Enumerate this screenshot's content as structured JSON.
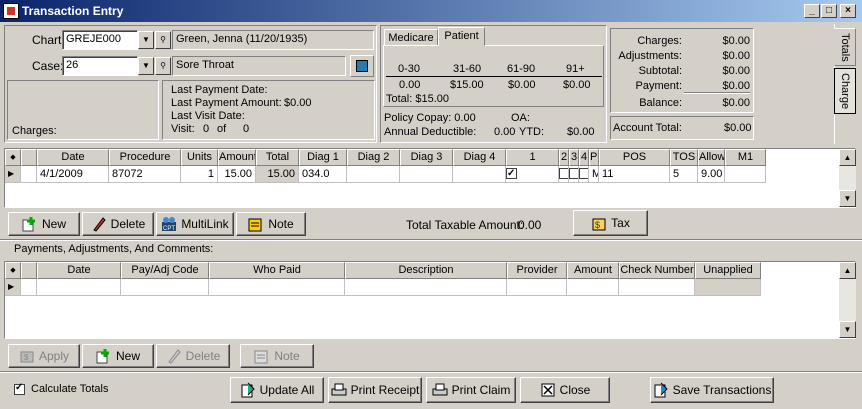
{
  "window": {
    "title": "Transaction Entry",
    "min": "_",
    "max": "□",
    "close": "×"
  },
  "patient": {
    "chart_label": "Chart:",
    "chart_value": "GREJE000",
    "name": "Green, Jenna  (11/20/1935)",
    "case_label": "Case:",
    "case_value": "26",
    "case_desc": "Sore Throat",
    "charges_label": "Charges:"
  },
  "last_info": {
    "l1": "Last Payment Date:",
    "l2": "Last Payment Amount:",
    "l2v": "$0.00",
    "l3": "Last Visit Date:",
    "l4": "Visit:",
    "l4a": "0",
    "l4b": "of",
    "l4c": "0"
  },
  "aging": {
    "tabs": [
      "Medicare",
      "Patient"
    ],
    "active_tab": "Patient",
    "headers": [
      "0-30",
      "31-60",
      "61-90",
      "91+"
    ],
    "values": [
      "0.00",
      "$15.00",
      "$0.00",
      "$0.00"
    ],
    "total": "Total: $15.00"
  },
  "policy": {
    "copay": "Policy Copay: 0.00",
    "oa": "OA:",
    "deduct": "Annual Deductible:",
    "deduct_v": "0.00",
    "ytd": "YTD:",
    "ytd_v": "$0.00"
  },
  "totals": {
    "rows": [
      [
        "Charges:",
        "$0.00"
      ],
      [
        "Adjustments:",
        "$0.00"
      ],
      [
        "Subtotal:",
        "$0.00"
      ],
      [
        "Payment:",
        "$0.00"
      ],
      [
        "Balance:",
        "$0.00"
      ]
    ],
    "account_label": "Account Total:",
    "account_value": "$0.00"
  },
  "side_tabs": [
    "Totals",
    "Charge"
  ],
  "charges_grid": {
    "columns": [
      "Date",
      "Procedure",
      "Units",
      "Amount",
      "Total",
      "Diag 1",
      "Diag 2",
      "Diag 3",
      "Diag 4",
      "1",
      "2",
      "3",
      "4",
      "Provider",
      "POS",
      "TOS",
      "Allowed",
      "M1"
    ],
    "row": {
      "date": "4/1/2009",
      "procedure": "87072",
      "units": "1",
      "amount": "15.00",
      "total": "15.00",
      "diag1": "034.0",
      "provider": "MM",
      "pos": "11",
      "tos": "5",
      "allowed": "9.00"
    }
  },
  "charge_buttons": {
    "new": "New",
    "delete": "Delete",
    "multilink": "MultiLink",
    "note": "Note",
    "taxable": "Total Taxable Amount:",
    "taxable_v": "0.00",
    "tax": "Tax"
  },
  "payments": {
    "section_label": "Payments, Adjustments, And Comments:",
    "columns": [
      "Date",
      "Pay/Adj Code",
      "Who Paid",
      "Description",
      "Provider",
      "Amount",
      "Check Number",
      "Unapplied"
    ]
  },
  "payment_buttons": {
    "apply": "Apply",
    "new": "New",
    "delete": "Delete",
    "note": "Note"
  },
  "footer": {
    "calc": "Calculate Totals",
    "update": "Update All",
    "print_receipt": "Print Receipt",
    "print_claim": "Print Claim",
    "close": "Close",
    "save": "Save Transactions"
  }
}
